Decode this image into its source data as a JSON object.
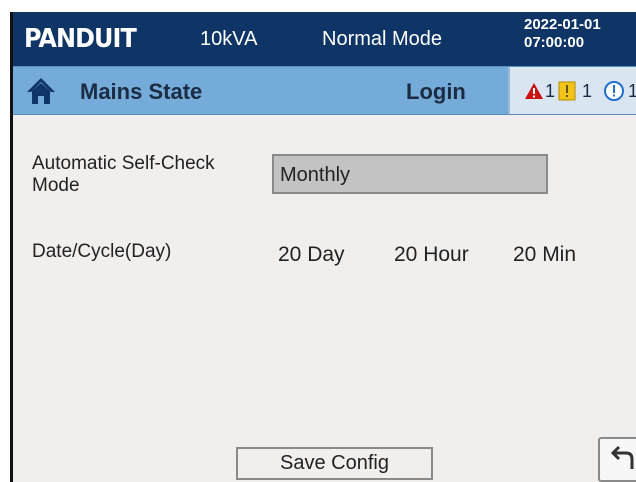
{
  "header": {
    "logo_text": "PANDUIT",
    "rating": "10kVA",
    "mode": "Normal Mode",
    "date": "2022-01-01",
    "time": "07:00:00"
  },
  "navbar": {
    "home_icon": "home-icon",
    "title": "Mains State",
    "login_label": "Login",
    "alarms": [
      {
        "icon": "warning-triangle-icon",
        "color": "#cc1111",
        "count": "1"
      },
      {
        "icon": "caution-square-icon",
        "color": "#f0c419",
        "count": "1"
      },
      {
        "icon": "info-circle-icon",
        "color": "#1f6fd1",
        "count": "1"
      }
    ]
  },
  "form": {
    "self_check_label_line1": "Automatic Self-Check",
    "self_check_label_line2": "Mode",
    "self_check_value": "Monthly",
    "cycle_label": "Date/Cycle(Day)",
    "cycle_day": "20 Day",
    "cycle_hour": "20 Hour",
    "cycle_min": "20 Min"
  },
  "footer": {
    "save_label": "Save Config",
    "back_icon": "back-arrow-icon"
  }
}
